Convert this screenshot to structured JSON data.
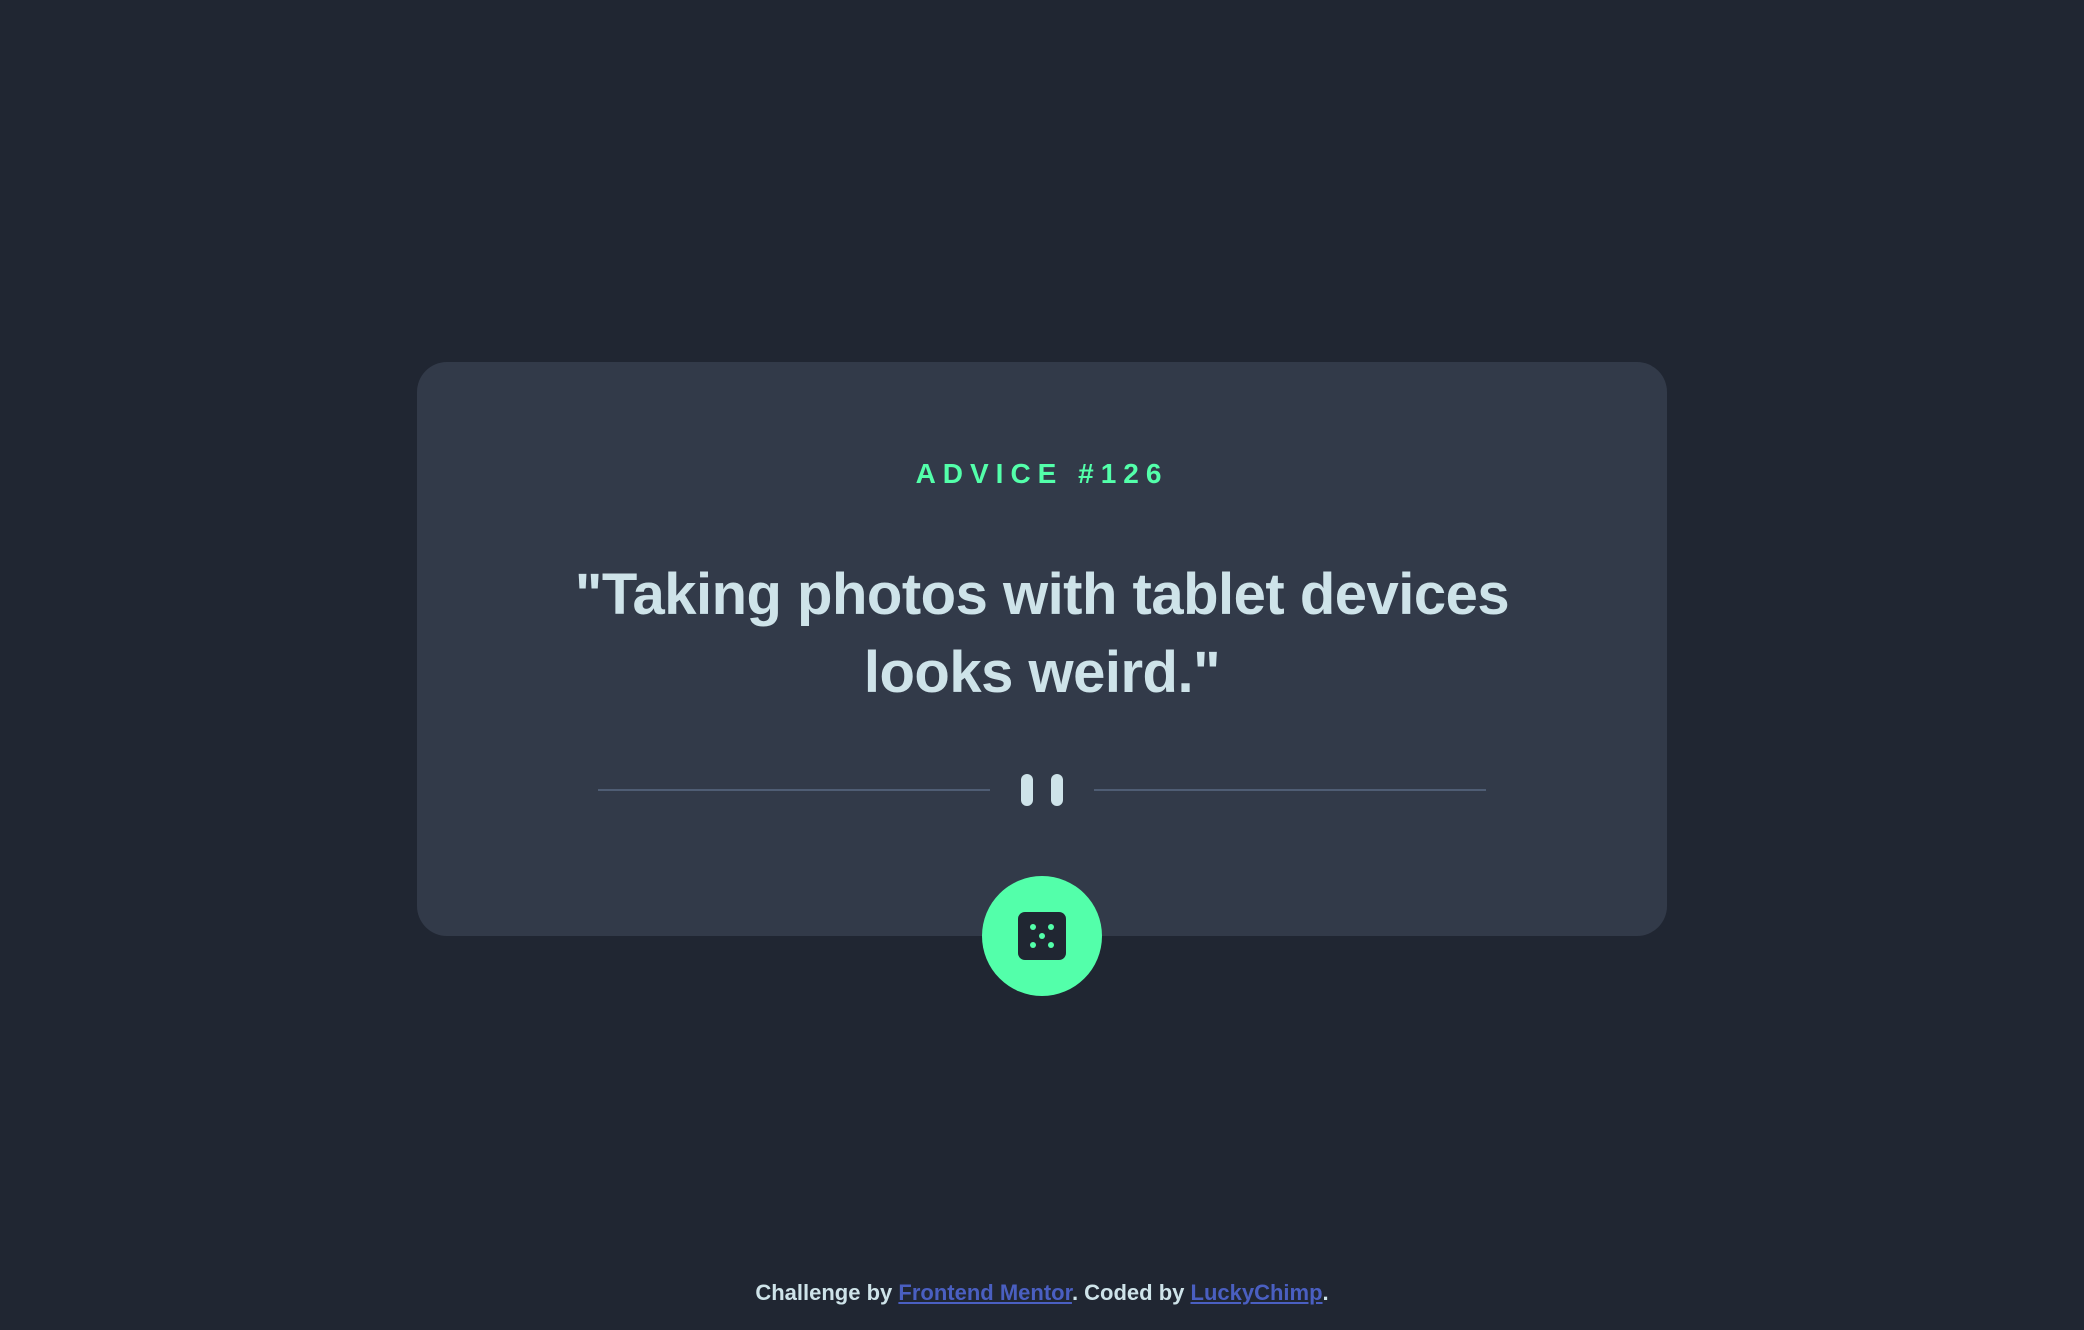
{
  "card": {
    "advice_label": "ADVICE #126",
    "quote": "\"Taking photos with tablet devices looks weird.\""
  },
  "icons": {
    "divider": "pause-icon",
    "dice": "dice-icon"
  },
  "footer": {
    "prefix": "Challenge by ",
    "link1": "Frontend Mentor",
    "middle": ". Coded by ",
    "link2": "LuckyChimp",
    "suffix": "."
  },
  "colors": {
    "background": "#202632",
    "card": "#323a49",
    "accent": "#53ffaa",
    "text": "#cee3e9",
    "link": "#4a5fc1"
  }
}
